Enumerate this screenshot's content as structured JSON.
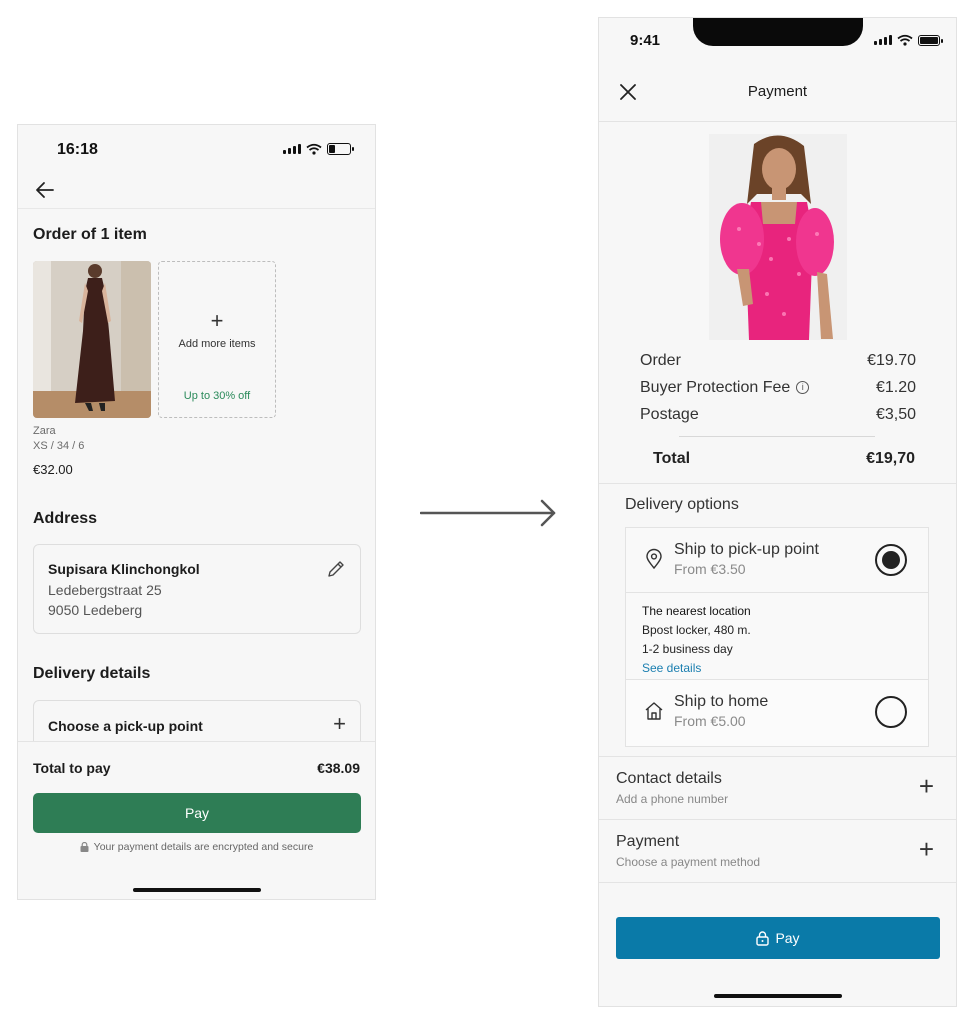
{
  "left": {
    "status_time": "16:18",
    "order_title": "Order of 1 item",
    "add_more_label": "Add more items",
    "add_more_promo": "Up to 30% off",
    "item": {
      "brand": "Zara",
      "size": "XS / 34 / 6",
      "price": "€32.00"
    },
    "address_title": "Address",
    "address": {
      "name": "Supisara Klinchongkol",
      "street": "Ledebergstraat 25",
      "city": "9050 Ledeberg"
    },
    "delivery_title": "Delivery details",
    "pickup_label": "Choose a pick-up point",
    "total_label": "Total to pay",
    "total_value": "€38.09",
    "pay_label": "Pay",
    "secure_note": "Your payment details are encrypted and secure",
    "colors": {
      "pay_button": "#2e7d55",
      "promo": "#2a8a5a"
    }
  },
  "right": {
    "status_time": "9:41",
    "title": "Payment",
    "summary": [
      {
        "label": "Order",
        "value": "€19.70"
      },
      {
        "label": "Buyer Protection Fee",
        "value": "€1.20"
      },
      {
        "label": "Postage",
        "value": "€3,50"
      }
    ],
    "total_label": "Total",
    "total_value": "€19,70",
    "delivery_title": "Delivery options",
    "options": {
      "pickup": {
        "title": "Ship to pick-up point",
        "sub": "From €3.50"
      },
      "home": {
        "title": "Ship to home",
        "sub": "From €5.00"
      }
    },
    "nearest": {
      "head": "The nearest location",
      "place": "Bpost locker, 480 m.",
      "time": "1-2 business day",
      "link": "See details"
    },
    "contact": {
      "title": "Contact details",
      "sub": "Add a phone number"
    },
    "payment": {
      "title": "Payment",
      "sub": "Choose a payment method"
    },
    "pay_label": "Pay",
    "colors": {
      "pay_button": "#0a7aa8",
      "link": "#1b7fb0"
    }
  }
}
